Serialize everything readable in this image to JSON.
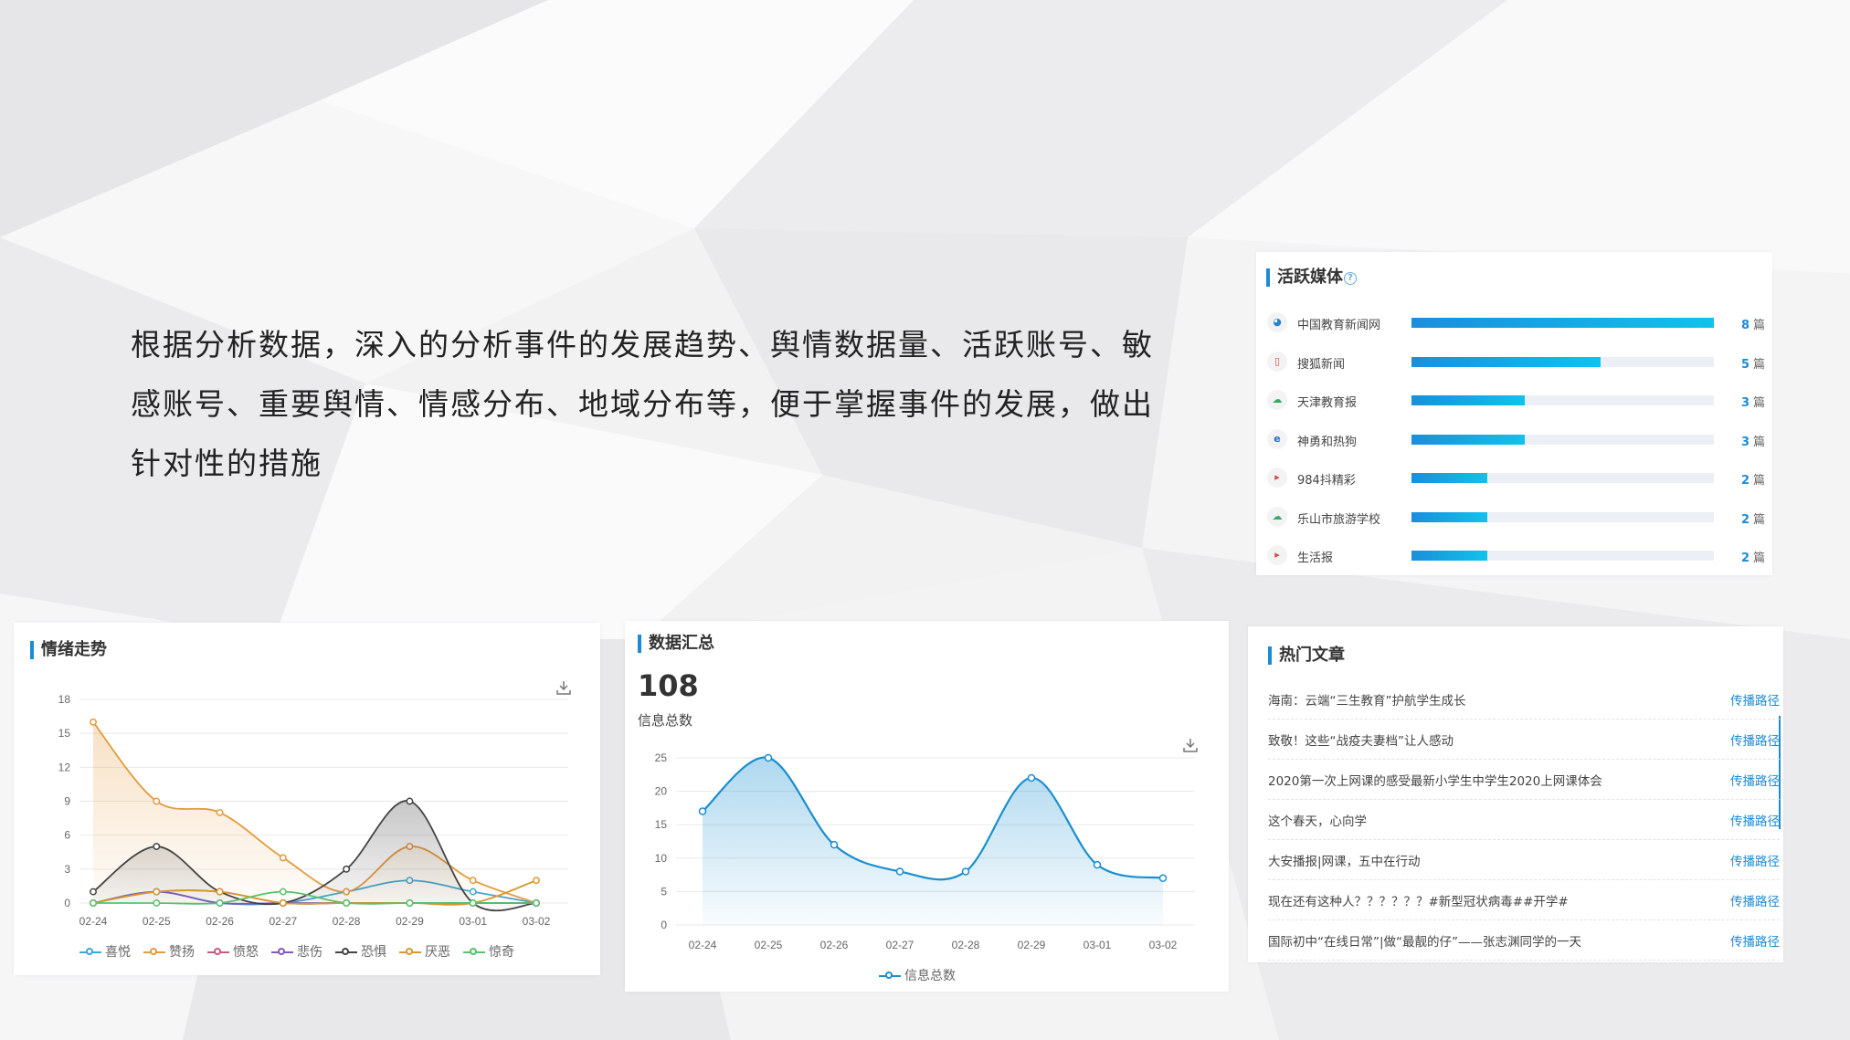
{
  "intro_text": "根据分析数据，深入的分析事件的发展趋势、舆情数据量、活跃账号、敏感账号、重要舆情、情感分布、地域分布等，便于掌握事件的发展，做出针对性的措施",
  "active_media": {
    "title": "活跃媒体",
    "unit": "篇",
    "items": [
      {
        "name": "中国教育新闻网",
        "count": 8,
        "icon": "globe-icon"
      },
      {
        "name": "搜狐新闻",
        "count": 5,
        "icon": "phone-icon"
      },
      {
        "name": "天津教育报",
        "count": 3,
        "icon": "wechat-icon"
      },
      {
        "name": "神勇和热狗",
        "count": 3,
        "icon": "ie-icon"
      },
      {
        "name": "984抖精彩",
        "count": 2,
        "icon": "play-icon"
      },
      {
        "name": "乐山市旅游学校",
        "count": 2,
        "icon": "wechat-icon"
      },
      {
        "name": "生活报",
        "count": 2,
        "icon": "play-icon"
      }
    ]
  },
  "emotion": {
    "title": "情绪走势"
  },
  "summary": {
    "title": "数据汇总",
    "total": "108",
    "total_label": "信息总数"
  },
  "hot_articles": {
    "title": "热门文章",
    "link_label": "传播路径",
    "items": [
      "海南：云端“三生教育”护航学生成长",
      "致敬！这些“战疫夫妻档”让人感动",
      "2020第一次上网课的感受最新小学生中学生2020上网课体会",
      "这个春天，心向学",
      "大安播报|网课，五中在行动",
      "现在还有这种人？？？？？？#新型冠状病毒##开学#",
      "国际初中“在线日常”|做“最靓的仔”——张志渊同学的一天"
    ]
  },
  "chart_data": [
    {
      "type": "area",
      "title": "",
      "categories": [
        "02-24",
        "02-25",
        "02-26",
        "02-27",
        "02-28",
        "02-29",
        "03-01",
        "03-02"
      ],
      "ylim": [
        0,
        18
      ],
      "yticks": [
        "0",
        "3",
        "6",
        "9",
        "12",
        "15",
        "18"
      ],
      "grid": true,
      "legend": "bottom",
      "series": [
        {
          "name": "喜悦",
          "color": "#3ea7d6",
          "values": [
            0,
            1,
            0,
            0,
            1,
            2,
            1,
            0
          ]
        },
        {
          "name": "赞扬",
          "color": "#e59a3c",
          "values": [
            16,
            9,
            8,
            4,
            1,
            5,
            2,
            0
          ]
        },
        {
          "name": "愤怒",
          "color": "#c85b7c",
          "values": [
            0,
            1,
            1,
            0,
            0,
            0,
            0,
            0
          ]
        },
        {
          "name": "悲伤",
          "color": "#7f5bbf",
          "values": [
            0,
            1,
            0,
            0,
            0,
            0,
            0,
            0
          ]
        },
        {
          "name": "恐惧",
          "color": "#444444",
          "values": [
            1,
            5,
            1,
            0,
            3,
            9,
            0,
            0
          ]
        },
        {
          "name": "厌恶",
          "color": "#d8992c",
          "values": [
            0,
            1,
            1,
            0,
            0,
            0,
            0,
            2
          ]
        },
        {
          "name": "惊奇",
          "color": "#58c26b",
          "values": [
            0,
            0,
            0,
            1,
            0,
            0,
            0,
            0
          ]
        }
      ]
    },
    {
      "type": "area",
      "title": "",
      "categories": [
        "02-24",
        "02-25",
        "02-26",
        "02-27",
        "02-28",
        "02-29",
        "03-01",
        "03-02"
      ],
      "ylim": [
        0,
        25
      ],
      "yticks": [
        "0",
        "5",
        "10",
        "15",
        "20",
        "25"
      ],
      "grid": true,
      "legend": "bottom",
      "series": [
        {
          "name": "信息总数",
          "color": "#1a8fcf",
          "values": [
            17,
            25,
            12,
            8,
            8,
            22,
            9,
            7
          ]
        }
      ]
    }
  ]
}
